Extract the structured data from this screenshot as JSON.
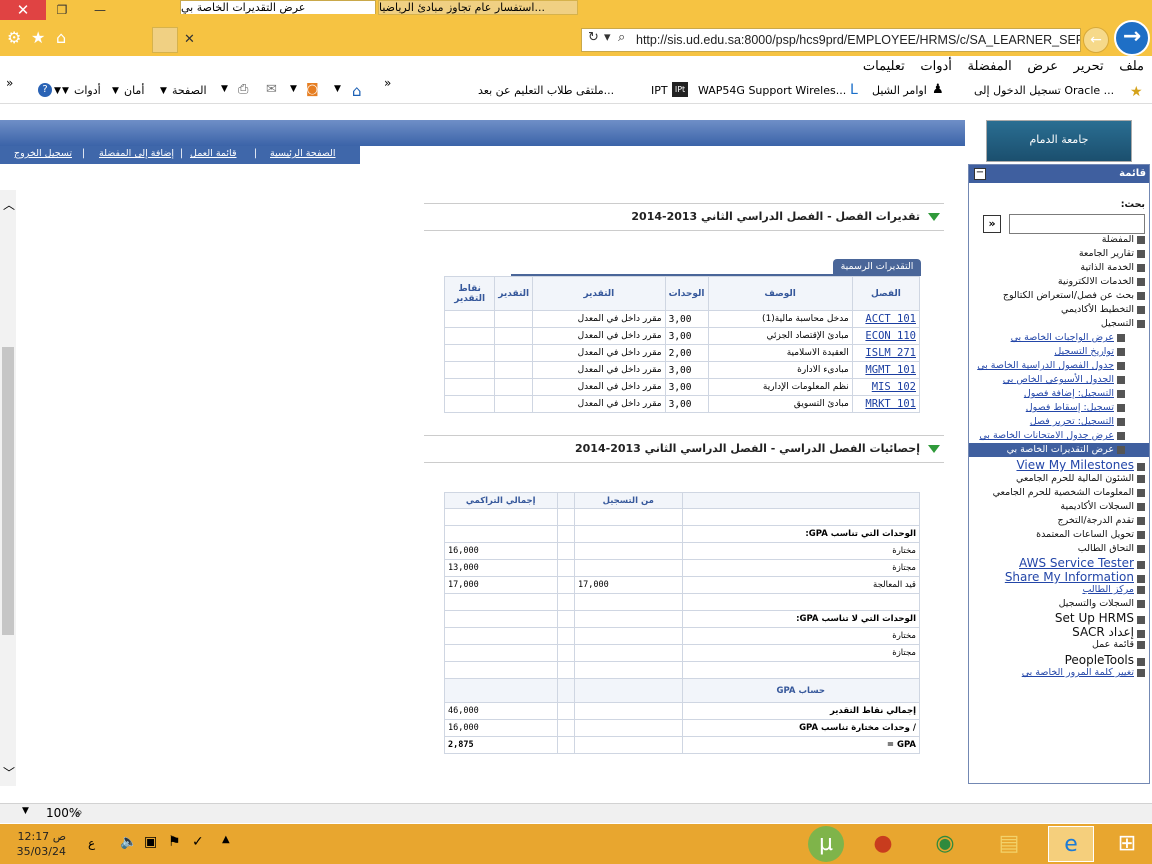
{
  "browser": {
    "url": "http://sis.ud.edu.sa:8000/psp/hcs9prd/EMPLOYEE/HRMS/c/SA_LEARNER_SERVI",
    "tabs": [
      {
        "title": "عرض التقديرات الخاصة بي"
      },
      {
        "title": "استفسار عام تجاوز مبادئ الرياضيا..."
      }
    ],
    "menu": [
      "ملف",
      "تحرير",
      "عرض",
      "المفضلة",
      "أدوات",
      "تعليمات"
    ],
    "favorites": [
      "تسجيل الدخول إلى Oracle ...",
      "اوامر الشيل",
      "WAP54G Support Wireles...",
      "IPT",
      "ملتقى طلاب التعليم عن بعد..."
    ],
    "command_bar": [
      "الصفحة",
      "أمان",
      "أدوات"
    ],
    "zoom": "100%"
  },
  "header": {
    "links": [
      "الصفحة الرئيسية",
      "قائمة العمل",
      "إضافة إلى المفضلة",
      "تسجيل الخروج"
    ],
    "logo_text": "جامعة الدمام"
  },
  "grades_section": {
    "title": "تقديرات الفصل - الفصل الدراسي الثاني 2013-2014",
    "tab_label": "التقديرات الرسمية",
    "columns": [
      "الفصل",
      "الوصف",
      "الوحدات",
      "التقدير",
      "التقدير",
      "نقاط التقدير"
    ],
    "rows": [
      {
        "code": "ACCT 101",
        "desc": "مدخل محاسبة مالية(1)",
        "units": "3,00",
        "grade": "مقرر داخل في المعدل",
        "grade2": "",
        "points": ""
      },
      {
        "code": "ECON 110",
        "desc": "مبادئ الإقتصاد الجزئي",
        "units": "3,00",
        "grade": "مقرر داخل في المعدل",
        "grade2": "",
        "points": ""
      },
      {
        "code": "ISLM 271",
        "desc": "العقيدة الاسلامية",
        "units": "2,00",
        "grade": "مقرر داخل في المعدل",
        "grade2": "",
        "points": ""
      },
      {
        "code": "MGMT 101",
        "desc": "مبادىء الادارة",
        "units": "3,00",
        "grade": "مقرر داخل في المعدل",
        "grade2": "",
        "points": ""
      },
      {
        "code": "MIS 102",
        "desc": "نظم المعلومات الإدارية",
        "units": "3,00",
        "grade": "مقرر داخل في المعدل",
        "grade2": "",
        "points": ""
      },
      {
        "code": "MRKT 101",
        "desc": "مبادئ التسويق",
        "units": "3,00",
        "grade": "مقرر داخل في المعدل",
        "grade2": "",
        "points": ""
      }
    ]
  },
  "stats_section": {
    "title": "إحصائيات الفصل الدراسي - الفصل الدراسي الثاني 2013-2014",
    "col_term": "من التسجيل",
    "col_cum": "إجمالي التراكمي",
    "gpa_units_title": "الوحدات التي تناسب GPA:",
    "taken": "مختارة",
    "passed": "مجتازة",
    "in_progress": "قيد المعالجة",
    "non_gpa_title": "الوحدات التي لا تناسب GPA:",
    "gpa_calc": "حساب GPA",
    "total_points": "إجمالي نقاط التقدير",
    "divide_label": "وحدات مختارة تناسب GPA",
    "divide_sign": "/",
    "gpa_label": "GPA =",
    "values": {
      "taken_cum": "16,000",
      "passed_cum": "13,000",
      "in_progress_term": "17,000",
      "in_progress_cum": "17,000",
      "total_points_cum": "46,000",
      "divide_cum": "16,000",
      "gpa_cum": "2,875"
    }
  },
  "nav": {
    "title": "قائمة",
    "search_label": "بحث:",
    "items": [
      {
        "label": "المفضلة",
        "type": "plain"
      },
      {
        "label": "تقارير الجامعة",
        "type": "plain"
      },
      {
        "label": "الخدمة الذاتية",
        "type": "plain"
      },
      {
        "label": "الخدمات الالكترونية",
        "type": "plain"
      },
      {
        "label": "بحث عن فصل/استعراض الكتالوج",
        "type": "plain"
      },
      {
        "label": "التخطيط الأكاديمي",
        "type": "plain"
      },
      {
        "label": "التسجيل",
        "type": "plain"
      },
      {
        "label": "عرض الواجبات الخاصة بي",
        "type": "link"
      },
      {
        "label": "تواريخ التسجيل",
        "type": "link"
      },
      {
        "label": "جدول الفصول الدراسية الخاصة بي",
        "type": "link"
      },
      {
        "label": "الجدول الأسبوعي الخاص بي",
        "type": "link"
      },
      {
        "label": "التسجيل: إضافة فصول",
        "type": "link"
      },
      {
        "label": "تسجيل: إسقاط فصول",
        "type": "link"
      },
      {
        "label": "التسجيل: تحرير فصل",
        "type": "link"
      },
      {
        "label": "عرض جدول الامتحانات الخاصة بي",
        "type": "link"
      },
      {
        "label": "عرض التقديرات الخاصة بي",
        "type": "selected"
      },
      {
        "label": "View My Milestones",
        "type": "link-big"
      },
      {
        "label": "الشئون المالية للحرم الجامعي",
        "type": "plain"
      },
      {
        "label": "المعلومات الشخصية للحرم الجامعي",
        "type": "plain"
      },
      {
        "label": "السجلات الأكاديمية",
        "type": "plain"
      },
      {
        "label": "تقدم الدرجة/التخرج",
        "type": "plain"
      },
      {
        "label": "تحويل الساعات المعتمدة",
        "type": "plain"
      },
      {
        "label": "التحاق الطالب",
        "type": "plain"
      },
      {
        "label": "AWS Service Tester",
        "type": "link-big"
      },
      {
        "label": "Share My Information",
        "type": "link-big"
      },
      {
        "label": "مركز الطالب",
        "type": "link"
      },
      {
        "label": "السجلات والتسجيل",
        "type": "plain"
      },
      {
        "label": "Set Up HRMS",
        "type": "plain-big"
      },
      {
        "label": "إعداد SACR",
        "type": "plain-big"
      },
      {
        "label": "قائمة عمل",
        "type": "plain"
      },
      {
        "label": "PeopleTools",
        "type": "plain-big"
      },
      {
        "label": "تغيير كلمة المرور الخاصة بي",
        "type": "link"
      }
    ]
  },
  "taskbar": {
    "time": "12:17 ص",
    "date": "35/03/24",
    "lang": "ع"
  }
}
